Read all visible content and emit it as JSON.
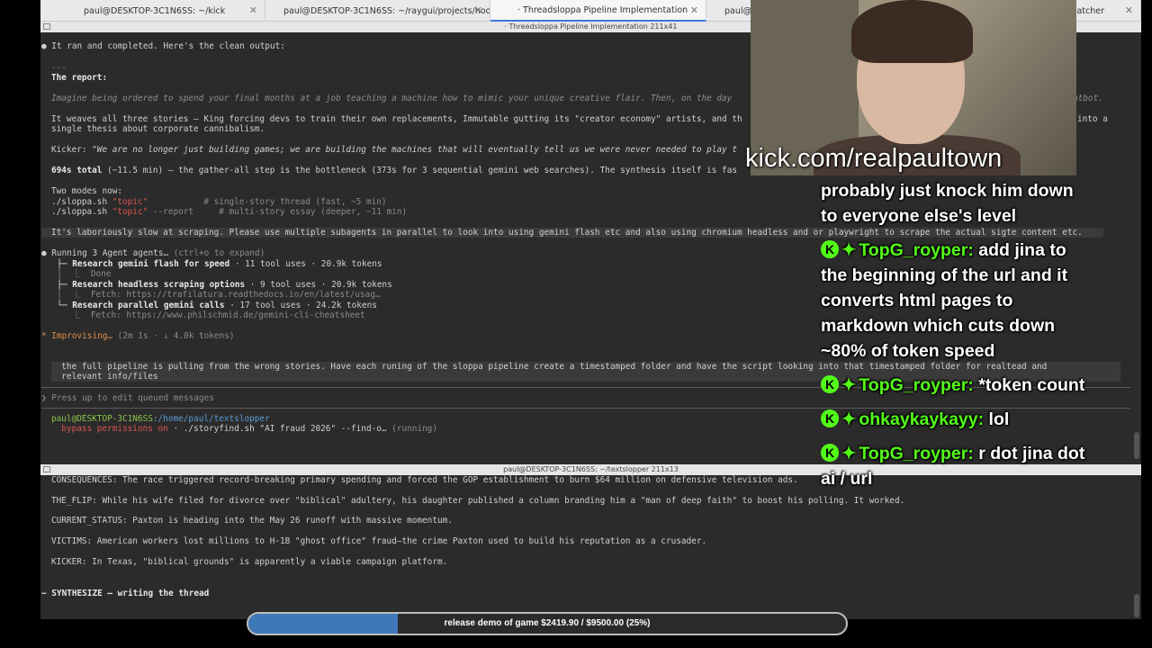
{
  "tabs": [
    {
      "label": "paul@DESKTOP-3C1N6SS: ~/kick"
    },
    {
      "label": "paul@DESKTOP-3C1N6SS: ~/raygui/projects/hoo..."
    },
    {
      "label": "· Threadsloppa Pipeline Implementation"
    },
    {
      "label": "paul@DE"
    },
    {
      "label": "-watcher"
    }
  ],
  "top_pane": {
    "title": "· Threadsloppa Pipeline Implementation 211x41",
    "lines": {
      "l1": "● It ran and completed. Here's the clean output:",
      "l2": "---",
      "l3": "The report:",
      "l4": "Imagine being ordered to spend your final months at a job teaching a machine how to mimic your unique creative flair. Then, on the day",
      "l4b": "atbot.",
      "l5": "It weaves all three stories — King forcing devs to train their own replacements, Immutable gutting its \"creator economy\" artists, and th",
      "l5b": "into a",
      "l6": "single thesis about corporate cannibalism.",
      "l7a": "Kicker: ",
      "l7b": "\"We are no longer just building games; we are building the machines that will eventually tell us we were never needed to play t",
      "l8a": "694s total",
      "l8b": " (~11.5 min) — the gather-all step is the bottleneck (373s for 3 sequential gemini web searches). The synthesis itself is fas",
      "l9": "Two modes now:",
      "l10a": "./sloppa.sh ",
      "l10b": "\"topic\"",
      "l10c": "           # single-story thread (fast, ~5 min)",
      "l11a": "./sloppa.sh ",
      "l11b": "\"topic\"",
      "l11c": " --report     # multi-story essay (deeper, ~11 min)",
      "l12": "It's laboriously slow at scraping. Please use multiple subagents in parallel to look into using gemini flash etc and also using chromium headless and or playwright to scrape the actual sigte content etc.",
      "l13a": "● Running 3 Agent agents…",
      "l13b": " (ctrl+o to expand)",
      "l14a": "  ├─ Research gemini flash for speed",
      "l14b": " · 11 tool uses · 20.9k tokens",
      "l15": "  │  ⎿  Done",
      "l16a": "  ├─ Research headless scraping options",
      "l16b": " · 9 tool uses · 20.9k tokens",
      "l17": "  │  ⎿  Fetch: https://trafilatura.readthedocs.io/en/latest/usag…",
      "l18a": "  └─ Research parallel gemini calls",
      "l18b": " · 17 tool uses · 24.2k tokens",
      "l19": "     ⎿  Fetch: https://www.philschmid.de/gemini-cli-cheatsheet",
      "l20a": "* Improvising…",
      "l20b": " (2m 1s · ↓ 4.0k tokens)",
      "l21": "  the full pipeline is pulling from the wrong stories. Have each runing of the sloppa pipeline create a timestamped folder and have the script looking into that timestamped folder for realtead and",
      "l22": "  relevant info/files",
      "l23": "❯ Press up to edit queued messages",
      "l24a": "paul@DESKTOP-3C1N6SS",
      "l24b": ":/home/paul/textslopper",
      "l25a": "  bypass permissions on",
      "l25b": " · ./storyfind.sh \"AI fraud 2026\" --find-o…",
      "l25c": " (running)"
    }
  },
  "bottom_pane": {
    "title": "paul@DESKTOP-3C1N6SS: ~/textslopper 211x13",
    "lines": {
      "b1": "CONSEQUENCES: The race triggered record-breaking primary spending and forced the GOP establishment to burn $64 million on defensive television ads.",
      "b2": "THE_FLIP: While his wife filed for divorce over \"biblical\" adultery, his daughter published a column branding him a \"man of deep faith\" to boost his polling. It worked.",
      "b3": "CURRENT_STATUS: Paxton is heading into the May 26 runoff with massive momentum.",
      "b4": "VICTIMS: American workers lost millions to H-1B \"ghost office\" fraud—the crime Paxton used to build his reputation as a crusader.",
      "b5": "KICKER: In Texas, \"biblical grounds\" is apparently a viable campaign platform.",
      "b6": "~ SYNTHESIZE — writing the thread"
    }
  },
  "overlay": {
    "kick_url": "kick.com/realpaultown",
    "chat": [
      {
        "user": "",
        "text": "probably just knock him down to everyone else's level"
      },
      {
        "user": "TopG_royper:",
        "text": "add jina to the beginning of the url and it converts html pages to markdown which cuts down ~80% of token speed"
      },
      {
        "user": "TopG_royper:",
        "text": "*token count"
      },
      {
        "user": "ohkaykaykayy:",
        "text": "lol"
      },
      {
        "user": "TopG_royper:",
        "text": "r dot jina dot ai / url"
      }
    ],
    "goal": {
      "label": "release demo of game $2419.90 / $9500.00 (25%)",
      "progress": 0.25,
      "fill_color": "#3f78b8"
    }
  },
  "colors": {
    "accent_green": "#53fc18",
    "terminal_bg": "#2b2b2b"
  }
}
